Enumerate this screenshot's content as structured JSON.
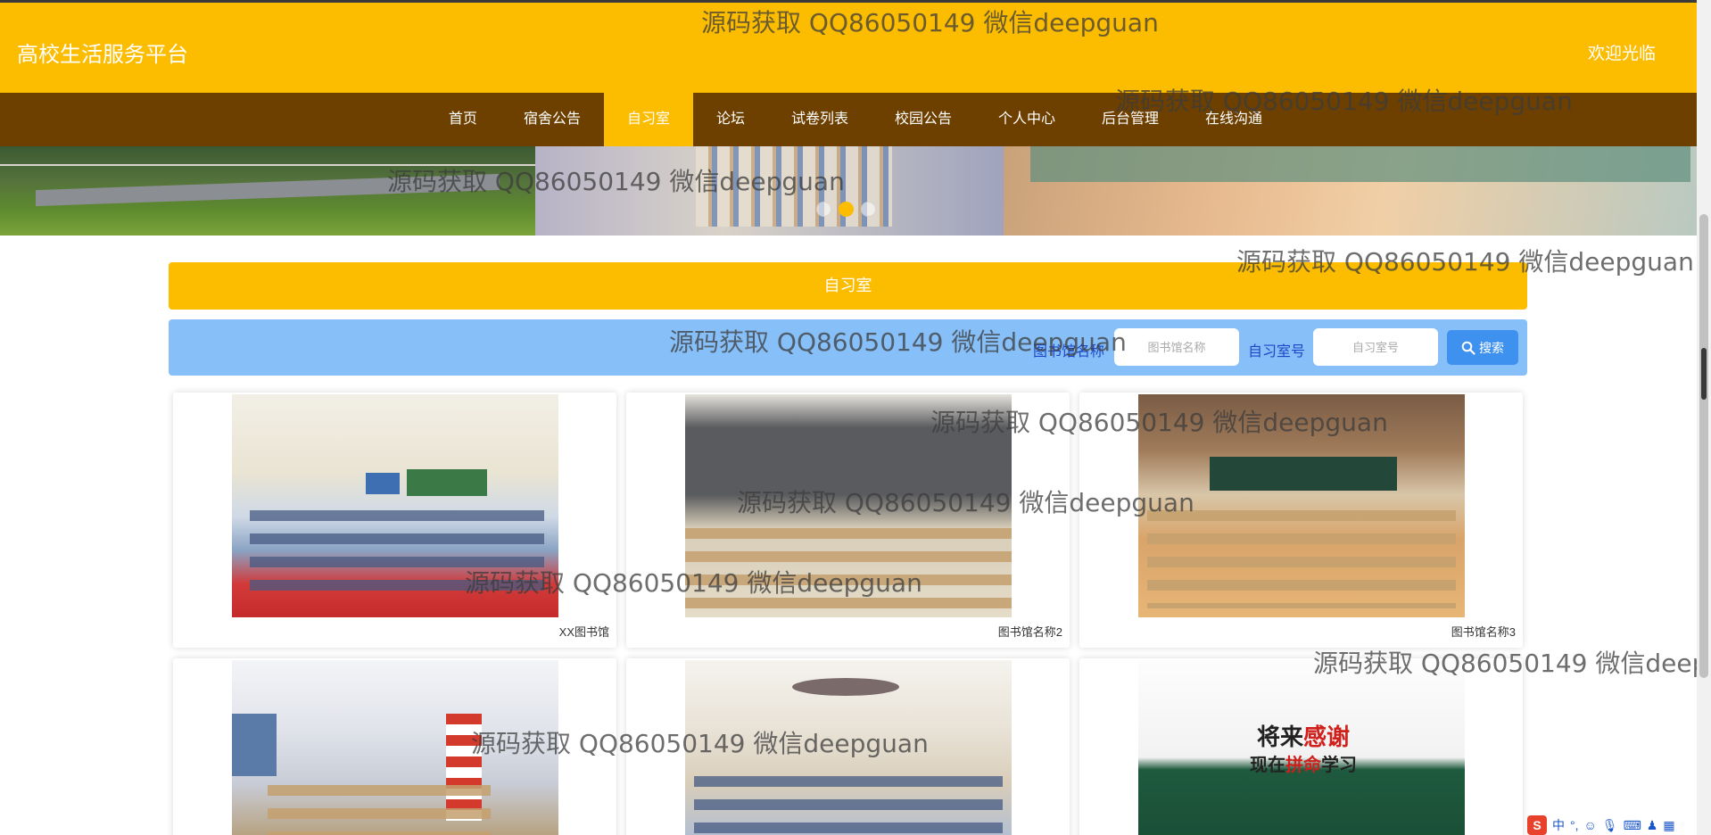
{
  "header": {
    "site_title": "高校生活服务平台",
    "welcome": "欢迎光临"
  },
  "nav": {
    "items": [
      "首页",
      "宿舍公告",
      "自习室",
      "论坛",
      "试卷列表",
      "校园公告",
      "个人中心",
      "后台管理",
      "在线沟通"
    ],
    "active": "自习室"
  },
  "banner": {
    "slides": 3,
    "active_slide": 2
  },
  "section": {
    "title": "自习室"
  },
  "search": {
    "library_label": "图书馆名称",
    "library_placeholder": "图书馆名称",
    "room_label": "自习室号",
    "room_placeholder": "自习室号",
    "button_label": "搜索"
  },
  "rooms": [
    {
      "name": "XX图书馆"
    },
    {
      "name": "图书馆名称2"
    },
    {
      "name": "图书馆名称3"
    },
    {
      "name": ""
    },
    {
      "name": ""
    },
    {
      "name": ""
    }
  ],
  "watermark": "源码获取 QQ86050149 微信deepguan",
  "ime": {
    "mode_char": "中"
  },
  "colors": {
    "header": "#fcbc00",
    "nav": "#6e4000",
    "search_bar": "#87bff8",
    "search_button": "#3e91ee",
    "label_text": "#1d47c8"
  }
}
